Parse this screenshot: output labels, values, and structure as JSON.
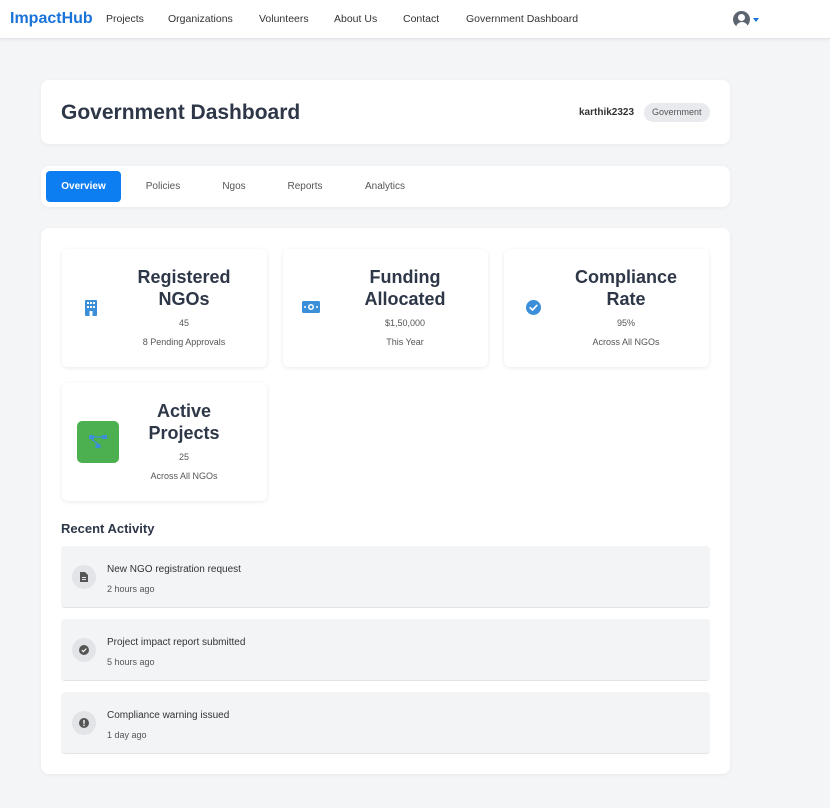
{
  "brand": "ImpactHub",
  "nav": {
    "links": [
      "Projects",
      "Organizations",
      "Volunteers",
      "About Us",
      "Contact",
      "Government Dashboard"
    ],
    "user_icon": "user-circle-icon",
    "caret_icon": "caret-down-icon"
  },
  "header": {
    "title": "Government Dashboard",
    "username": "karthik2323",
    "role": "Government"
  },
  "tabs": [
    "Overview",
    "Policies",
    "Ngos",
    "Reports",
    "Analytics"
  ],
  "active_tab": "Overview",
  "stats": [
    {
      "title": "Registered NGOs",
      "value": "45",
      "subtitle": "8 Pending Approvals",
      "icon": "building-icon"
    },
    {
      "title": "Funding Allocated",
      "value": "$1,50,000",
      "subtitle": "This Year",
      "icon": "money-bill-icon"
    },
    {
      "title": "Compliance Rate",
      "value": "95%",
      "subtitle": "Across All NGOs",
      "icon": "check-circle-icon"
    },
    {
      "title": "Active Projects",
      "value": "25",
      "subtitle": "Across All NGOs",
      "icon": "project-diagram-icon"
    }
  ],
  "recent_activity": {
    "title": "Recent Activity",
    "items": [
      {
        "text": "New NGO registration request",
        "time": "2 hours ago",
        "icon": "file-icon"
      },
      {
        "text": "Project impact report submitted",
        "time": "5 hours ago",
        "icon": "check-circle-icon"
      },
      {
        "text": "Compliance warning issued",
        "time": "1 day ago",
        "icon": "exclamation-circle-icon"
      }
    ]
  },
  "colors": {
    "brand": "#1a73d9",
    "primary": "#0d7ef2",
    "icon_blue": "#3b8fd9",
    "projects_tile": "#4caf50",
    "page_bg": "#f4f5f7"
  }
}
